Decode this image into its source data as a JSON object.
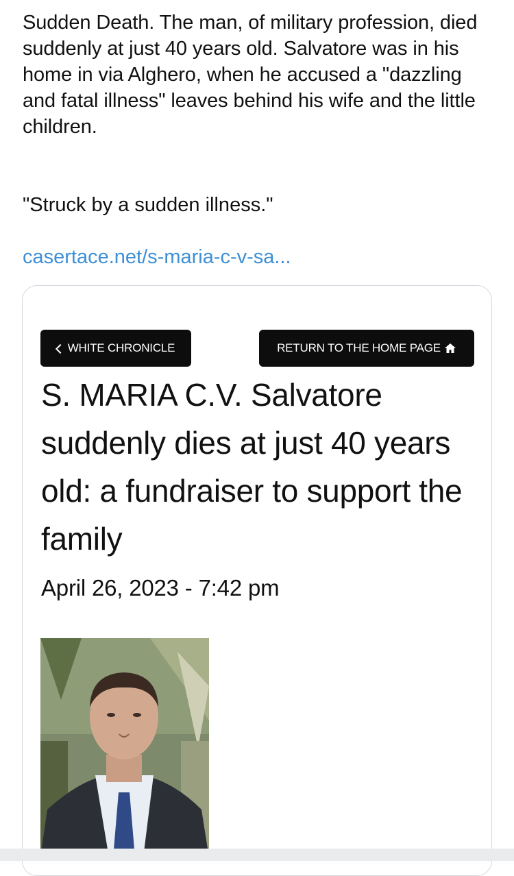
{
  "post": {
    "body": "Sudden Death. The man, of military profession, died suddenly at just 40 years old. Salvatore was in his home in via Alghero, when he accused a \"dazzling and fatal illness\" leaves behind his wife and the little children.",
    "quote": "\"Struck by a sudden illness.\"",
    "link": "casertace.net/s-maria-c-v-sa..."
  },
  "preview": {
    "back_button": "WHITE CHRONICLE",
    "home_button": "RETURN TO THE HOME PAGE",
    "headline": "S. MARIA C.V. Salvatore suddenly dies at just 40 years old: a fundraiser to support the family",
    "date": "April 26, 2023 - 7:42 pm"
  },
  "colors": {
    "link": "#3d8fd6",
    "button_bg": "#0d0d0d",
    "card_border": "#d3d8de"
  },
  "icons": [
    "chevron-left-icon",
    "home-icon"
  ]
}
